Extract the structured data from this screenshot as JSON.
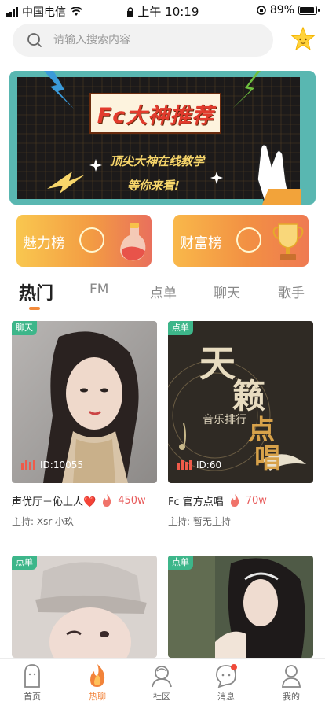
{
  "status_bar": {
    "carrier": "中国电信",
    "time": "上午 10:19",
    "battery": "89%",
    "battery_level": 0.89
  },
  "search": {
    "placeholder": "请输入搜索内容"
  },
  "banner": {
    "title": "Fc大神推荐",
    "line1": "顶尖大神在线教学",
    "line2": "等你来看!"
  },
  "rank_cards": [
    {
      "label": "魅力榜"
    },
    {
      "label": "财富榜"
    }
  ],
  "tabs": [
    {
      "label": "热门",
      "active": true
    },
    {
      "label": "FM"
    },
    {
      "label": "点单"
    },
    {
      "label": "聊天"
    },
    {
      "label": "歌手"
    }
  ],
  "rooms": [
    {
      "tag": "聊天",
      "id": "ID:10055",
      "title": "声优厅－伈上人❤️",
      "heat": "450w",
      "host": "主持: Xsr-小玖"
    },
    {
      "tag": "点单",
      "id": "ID:60",
      "title": "Fc 官方点唱",
      "heat": "70w",
      "host": "主持: 暂无主持",
      "cover_text": [
        "天",
        "籁",
        "点",
        "唱",
        "音乐排行"
      ]
    },
    {
      "tag": "点单"
    },
    {
      "tag": "点单"
    }
  ],
  "bottom_nav": [
    {
      "label": "首页",
      "icon": "home-icon"
    },
    {
      "label": "热聊",
      "icon": "flame-icon",
      "active": true
    },
    {
      "label": "社区",
      "icon": "community-icon"
    },
    {
      "label": "消息",
      "icon": "message-icon"
    },
    {
      "label": "我的",
      "icon": "profile-icon"
    }
  ],
  "colors": {
    "accent": "#f2833a",
    "tag_green": "#3db68a",
    "heat_red": "#e85c5c",
    "banner_teal": "#59b7b1"
  }
}
